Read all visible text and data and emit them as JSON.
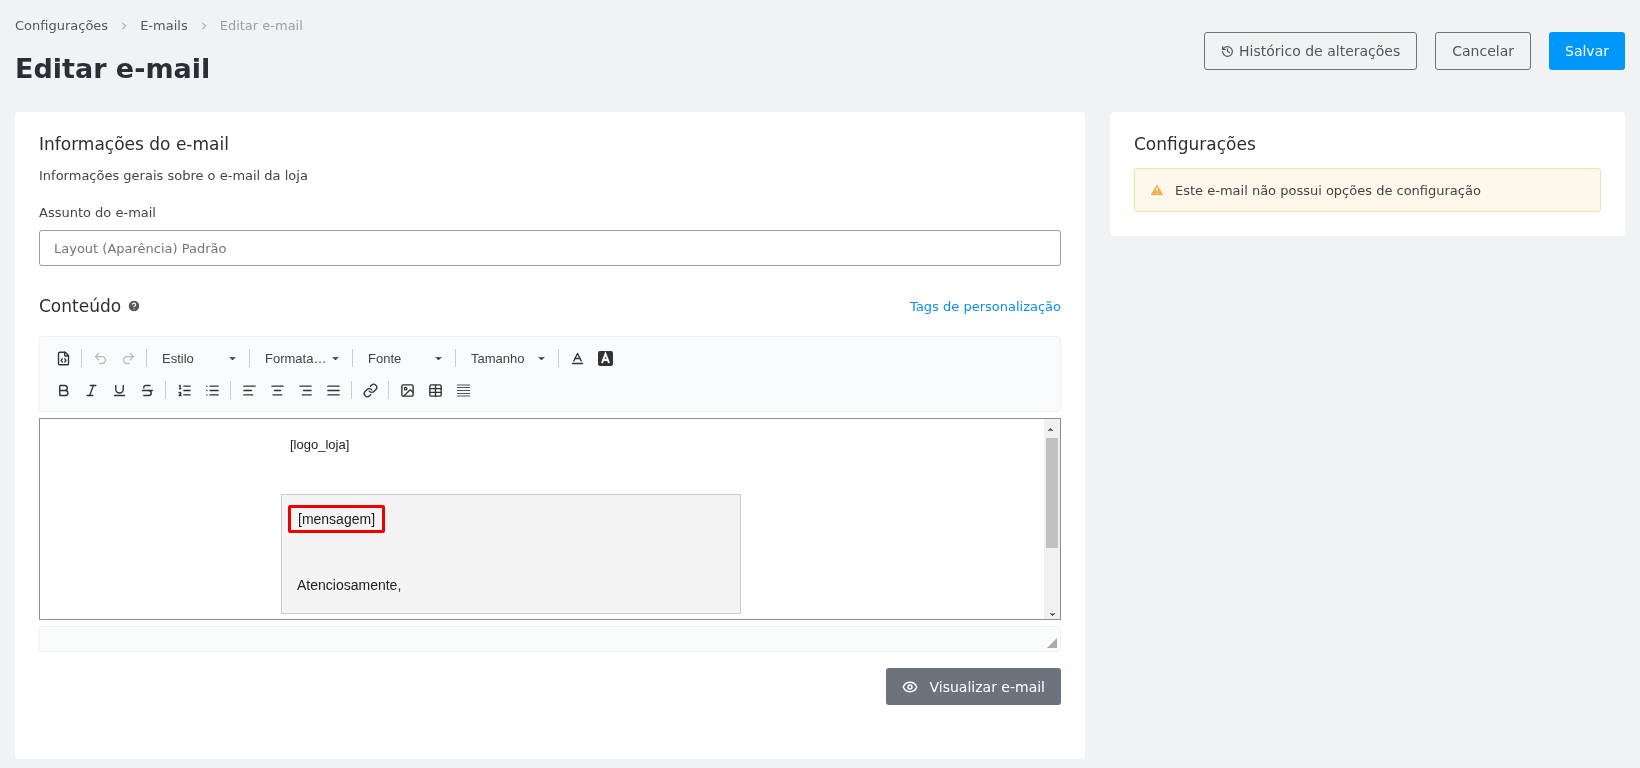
{
  "breadcrumb": [
    {
      "label": "Configurações",
      "current": false
    },
    {
      "label": "E-mails",
      "current": false
    },
    {
      "label": "Editar e-mail",
      "current": true
    }
  ],
  "title": "Editar e-mail",
  "actions": [
    {
      "label": "Histórico de alterações",
      "kind": "history"
    },
    {
      "label": "Cancelar",
      "kind": "outline"
    },
    {
      "label": "Salvar",
      "kind": "primary"
    }
  ],
  "email_info": {
    "title": "Informações do e-mail",
    "subtitle": "Informações gerais sobre o e-mail da loja",
    "subject_label": "Assunto do e-mail",
    "placeholder": "Layout (Aparência) Padrão"
  },
  "content": {
    "title": "Conteúdo",
    "tags_link": "Tags de personalização",
    "toolbar": {
      "undo": {
        "disabled": true
      },
      "redo": {
        "disabled": true
      },
      "dropdowns": [
        {
          "label": "Estilo"
        },
        {
          "label": "Formata…"
        },
        {
          "label": "Fonte"
        },
        {
          "label": "Tamanho"
        }
      ]
    },
    "editor": {
      "logo": "[logo_loja]",
      "message": "[mensagem]",
      "message_highlighted": true,
      "closing": "Atenciosamente,"
    },
    "preview_button": "Visualizar e-mail"
  },
  "settings": {
    "title": "Configurações",
    "warning": "Este e-mail não possui opções de configuração"
  }
}
